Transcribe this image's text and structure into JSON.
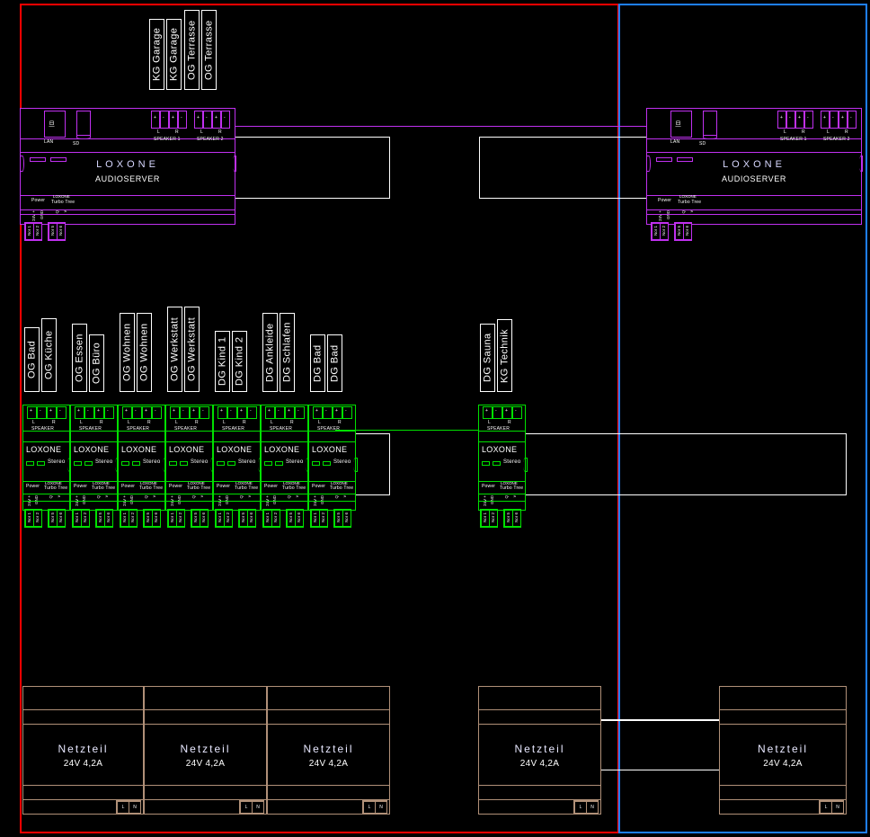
{
  "panels": {
    "left": {
      "border_color": "#ff0000"
    },
    "right": {
      "border_color": "#1e7fff"
    }
  },
  "top_tags": [
    {
      "label": "KG Garage"
    },
    {
      "label": "KG Garage"
    },
    {
      "label": "OG Terrasse"
    },
    {
      "label": "OG Terrasse"
    }
  ],
  "audioservers": [
    {
      "brand": "LOXONE",
      "model": "AUDIOSERVER",
      "lan_label": "LAN",
      "sd_label": "SD",
      "speaker1_label": "SPEAKER 1",
      "speaker2_label": "SPEAKER 2",
      "channel_left": "L",
      "channel_right": "R",
      "polarity_plus": "+",
      "polarity_minus": "-",
      "power_label": "Power",
      "tree_label": "LOXONE",
      "tree_sub": "Turbo Tree",
      "terminal_24v": "24V +",
      "terminal_gnd": "GND",
      "terminal_tree_a": "Q",
      "terminal_tree_b": "v",
      "terminal_nums": [
        "Nor 1",
        "Nor 2",
        "Nor 5",
        "Nor 6"
      ]
    },
    {
      "brand": "LOXONE",
      "model": "AUDIOSERVER",
      "lan_label": "LAN",
      "sd_label": "SD",
      "speaker1_label": "SPEAKER 1",
      "speaker2_label": "SPEAKER 2",
      "channel_left": "L",
      "channel_right": "R",
      "polarity_plus": "+",
      "polarity_minus": "-",
      "power_label": "Power",
      "tree_label": "LOXONE",
      "tree_sub": "Turbo Tree",
      "terminal_24v": "24V +",
      "terminal_gnd": "GND",
      "terminal_tree_a": "Q",
      "terminal_tree_b": "v",
      "terminal_nums": [
        "Nor 1",
        "Nor 2",
        "Nor 5",
        "Nor 6"
      ]
    }
  ],
  "room_tags_left": [
    {
      "label": "OG Bad"
    },
    {
      "label": "OG Küche"
    },
    {
      "label": "OG Essen"
    },
    {
      "label": "OG Büro"
    },
    {
      "label": "OG Wohnen"
    },
    {
      "label": "OG Wohnen"
    },
    {
      "label": "OG Werkstatt"
    },
    {
      "label": "OG Werkstatt"
    },
    {
      "label": "DG Kind 1"
    },
    {
      "label": "DG Kind 2"
    },
    {
      "label": "DG Ankleide"
    },
    {
      "label": "DG Schlafen"
    },
    {
      "label": "DG Bad"
    },
    {
      "label": "DG Bad"
    }
  ],
  "room_tags_right": [
    {
      "label": "DG Sauna"
    },
    {
      "label": "KG Technik"
    }
  ],
  "stereo_extension": {
    "brand": "LOXONE",
    "model": "Stereo",
    "speaker_label": "SPEAKER",
    "channel_left": "L",
    "channel_right": "R",
    "polarity_plus": "+",
    "polarity_minus": "-",
    "power_label": "Power",
    "tree_label": "LOXONE",
    "tree_sub": "Turbo Tree",
    "terminal_24v": "24V +",
    "terminal_gnd": "GND",
    "terminal_tree_a": "Q",
    "terminal_tree_b": "v",
    "terminal_nums": [
      "Nor 1",
      "Nor 2",
      "Nor 5",
      "Nor 6"
    ]
  },
  "extension_count_left": 7,
  "extension_count_right": 1,
  "power_supplies": [
    {
      "title": "Netzteil",
      "rating": "24V 4,2A",
      "terminal_l": "L",
      "terminal_n": "N"
    },
    {
      "title": "Netzteil",
      "rating": "24V 4,2A",
      "terminal_l": "L",
      "terminal_n": "N"
    },
    {
      "title": "Netzteil",
      "rating": "24V 4,2A",
      "terminal_l": "L",
      "terminal_n": "N"
    },
    {
      "title": "Netzteil",
      "rating": "24V 4,2A",
      "terminal_l": "L",
      "terminal_n": "N"
    },
    {
      "title": "Netzteil",
      "rating": "24V 4,2A",
      "terminal_l": "L",
      "terminal_n": "N"
    }
  ],
  "colors": {
    "audioserver": "#c030f0",
    "extension": "#00e000",
    "psu": "#b09078",
    "rail": "#ffffff",
    "panel_left": "#ff0000",
    "panel_right": "#1e7fff"
  }
}
